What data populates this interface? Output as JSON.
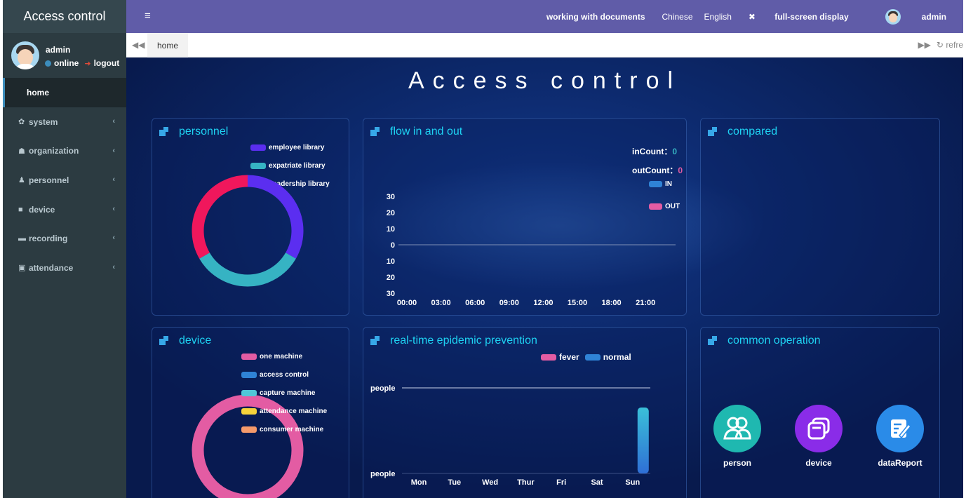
{
  "app": {
    "title": "Access control"
  },
  "user": {
    "name": "admin",
    "status": "online",
    "logout": "logout"
  },
  "sidebar": {
    "items": [
      {
        "label": "home",
        "icon": "home"
      },
      {
        "label": "system",
        "icon": "gear-icon"
      },
      {
        "label": "organization",
        "icon": "users-icon"
      },
      {
        "label": "personnel",
        "icon": "user-icon"
      },
      {
        "label": "device",
        "icon": "video-camera-icon"
      },
      {
        "label": "recording",
        "icon": "recording-icon"
      },
      {
        "label": "attendance",
        "icon": "calendar-icon"
      }
    ]
  },
  "header": {
    "docs": "working with documents",
    "lang_cn": "Chinese",
    "lang_en": "English",
    "fullscreen": "full-screen display",
    "user": "admin"
  },
  "tabs": {
    "home": "home",
    "refresh": "refre"
  },
  "dashboard": {
    "title": "Access control",
    "personnel": {
      "title": "personnel",
      "legend": [
        "employee library",
        "expatriate library",
        "Leadership library"
      ],
      "colors": [
        "#5b2ef0",
        "#36b3c3",
        "#f0175c"
      ]
    },
    "flow": {
      "title": "flow in and out",
      "in_label": "inCount：",
      "in_value": "0",
      "out_label": "outCount：",
      "out_value": "0",
      "legend": [
        "IN",
        "OUT"
      ]
    },
    "compared": {
      "title": "compared"
    },
    "device": {
      "title": "device",
      "legend": [
        "one machine",
        "access control",
        "capture machine",
        "attendance machine",
        "consumer machine"
      ],
      "colors": [
        "#e35ca3",
        "#2f83d6",
        "#4fc7d8",
        "#f5d33b",
        "#f59a6b"
      ]
    },
    "epidemic": {
      "title": "real-time epidemic prevention",
      "legend": [
        "fever",
        "normal"
      ],
      "ylabels": [
        "people",
        "people"
      ]
    },
    "common": {
      "title": "common operation",
      "ops": [
        {
          "label": "person",
          "icon": "person-group-icon",
          "color": "#1fb8b0"
        },
        {
          "label": "device",
          "icon": "device-window-icon",
          "color": "#8a2ce8"
        },
        {
          "label": "dataReport",
          "icon": "report-edit-icon",
          "color": "#2a8be8"
        }
      ]
    }
  },
  "chart_data": [
    {
      "type": "pie",
      "categories": [
        "employee library",
        "expatriate library",
        "Leadership library"
      ],
      "values": [
        1,
        1,
        1
      ]
    },
    {
      "type": "line",
      "x": [
        "00:00",
        "03:00",
        "06:00",
        "09:00",
        "12:00",
        "15:00",
        "18:00",
        "21:00"
      ],
      "yticks": [
        30,
        20,
        10,
        0,
        10,
        20,
        30
      ],
      "ylim": [
        -30,
        30
      ],
      "series": [
        {
          "name": "IN",
          "values": [
            0,
            0,
            0,
            0,
            0,
            0,
            0,
            0
          ]
        },
        {
          "name": "OUT",
          "values": [
            0,
            0,
            0,
            0,
            0,
            0,
            0,
            0
          ]
        }
      ]
    },
    {
      "type": "pie",
      "categories": [
        "one machine",
        "access control",
        "capture machine",
        "attendance machine",
        "consumer machine"
      ],
      "values": [
        1,
        0,
        0,
        0,
        0
      ]
    },
    {
      "type": "bar",
      "categories": [
        "Mon",
        "Tue",
        "Wed",
        "Thur",
        "Fri",
        "Sat",
        "Sun"
      ],
      "series": [
        {
          "name": "fever",
          "values": [
            0,
            0,
            0,
            0,
            0,
            0,
            0
          ]
        },
        {
          "name": "normal",
          "values": [
            0,
            0,
            0,
            0,
            0,
            0,
            1
          ]
        }
      ]
    }
  ]
}
